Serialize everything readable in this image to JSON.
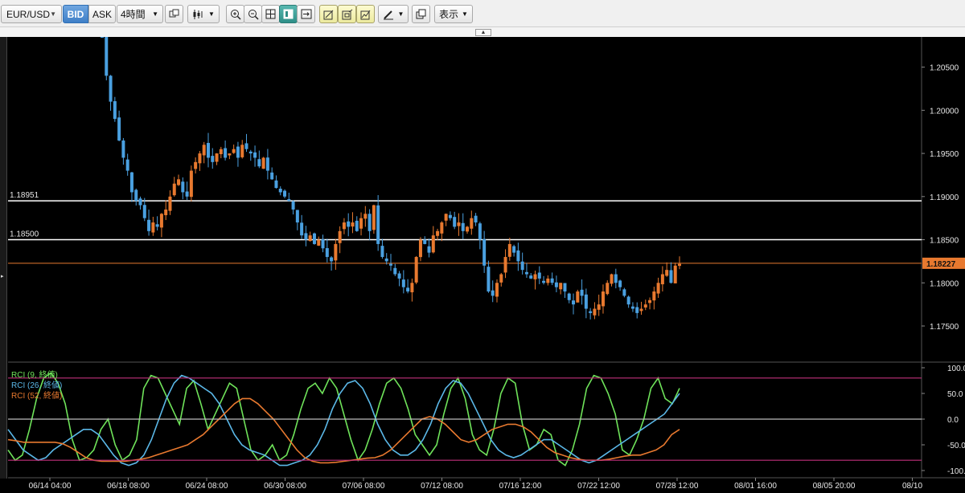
{
  "toolbar": {
    "symbol": "EUR/USD",
    "bid_label": "BID",
    "ask_label": "ASK",
    "timeframe": "4時間",
    "display_label": "表示",
    "icons": [
      "copy-icon",
      "candlestick-icon",
      "zoom-in-icon",
      "zoom-out-icon",
      "grid-icon",
      "panel-icon",
      "fit-icon",
      "draw-trend-icon",
      "draw-channel-icon",
      "draw-fib-icon",
      "pen-icon",
      "window-icon"
    ]
  },
  "chart_data": [
    {
      "type": "candlestick",
      "title": "EUR/USD 4時間",
      "x_ticks": [
        "06/14 04:00",
        "06/18 08:00",
        "06/24 08:00",
        "06/30 08:00",
        "07/06 08:00",
        "07/12 08:00",
        "07/16 12:00",
        "07/22 12:00",
        "07/28 12:00",
        "08/01 16:00",
        "08/05 20:00",
        "08/10"
      ],
      "y_ticks": [
        "1.20500",
        "1.20000",
        "1.19500",
        "1.19000",
        "1.18500",
        "1.18000",
        "1.17500"
      ],
      "ylim": [
        1.171,
        1.2085
      ],
      "current_price": "1.18227",
      "horizontal_levels": [
        "1.18951",
        "1.18500"
      ],
      "colors": {
        "up": "#e8792f",
        "down": "#4aa0e0",
        "level": "#ffffff",
        "current": "#e8792f"
      },
      "closes": [
        1.2095,
        1.204,
        1.201,
        1.199,
        1.1965,
        1.1945,
        1.193,
        1.1905,
        1.1895,
        1.189,
        1.1875,
        1.186,
        1.187,
        1.1865,
        1.188,
        1.1885,
        1.19,
        1.1915,
        1.192,
        1.1905,
        1.19,
        1.193,
        1.194,
        1.195,
        1.196,
        1.1945,
        1.194,
        1.195,
        1.1955,
        1.1945,
        1.195,
        1.1955,
        1.1945,
        1.196,
        1.1955,
        1.195,
        1.1945,
        1.1935,
        1.1945,
        1.193,
        1.192,
        1.191,
        1.1905,
        1.19,
        1.1895,
        1.1885,
        1.187,
        1.1855,
        1.185,
        1.1855,
        1.1845,
        1.185,
        1.184,
        1.183,
        1.1825,
        1.1845,
        1.186,
        1.187,
        1.1865,
        1.187,
        1.186,
        1.1875,
        1.188,
        1.186,
        1.189,
        1.1845,
        1.183,
        1.1825,
        1.182,
        1.181,
        1.1805,
        1.1795,
        1.179,
        1.18,
        1.183,
        1.185,
        1.1845,
        1.1835,
        1.1855,
        1.186,
        1.187,
        1.188,
        1.1875,
        1.1865,
        1.187,
        1.186,
        1.1865,
        1.1875,
        1.187,
        1.185,
        1.182,
        1.179,
        1.1785,
        1.18,
        1.181,
        1.183,
        1.1845,
        1.1835,
        1.1825,
        1.1815,
        1.181,
        1.1805,
        1.181,
        1.1805,
        1.18,
        1.1805,
        1.18,
        1.1795,
        1.18,
        1.179,
        1.178,
        1.1775,
        1.179,
        1.1785,
        1.177,
        1.1765,
        1.177,
        1.1775,
        1.179,
        1.18,
        1.181,
        1.18,
        1.1795,
        1.1785,
        1.1775,
        1.177,
        1.1765,
        1.177,
        1.1775,
        1.178,
        1.179,
        1.18,
        1.181,
        1.1815,
        1.18,
        1.182,
        1.1822
      ]
    },
    {
      "type": "line",
      "title": "RCI",
      "y_ticks": [
        "100.0",
        "50.0",
        "0.0",
        "-50.0",
        "-100.0"
      ],
      "ylim": [
        -100,
        100
      ],
      "reference_lines": [
        80,
        0,
        -80
      ],
      "series": [
        {
          "name": "RCI (9, 終値)",
          "color": "#6fe35a",
          "values": [
            -60,
            -80,
            -70,
            -20,
            40,
            80,
            90,
            70,
            30,
            -40,
            -80,
            -75,
            -60,
            -20,
            0,
            -50,
            -80,
            -70,
            -40,
            60,
            85,
            80,
            50,
            20,
            -10,
            60,
            75,
            30,
            -20,
            10,
            40,
            70,
            60,
            0,
            -60,
            -80,
            -70,
            -50,
            -80,
            -70,
            -30,
            20,
            60,
            70,
            50,
            80,
            60,
            10,
            -40,
            -80,
            -60,
            -20,
            30,
            70,
            80,
            60,
            20,
            -30,
            -50,
            -70,
            -50,
            10,
            60,
            80,
            40,
            -30,
            -60,
            -70,
            -20,
            50,
            80,
            70,
            -10,
            -60,
            -50,
            -20,
            -30,
            -80,
            -90,
            -60,
            -10,
            60,
            85,
            80,
            50,
            10,
            -60,
            -70,
            -40,
            0,
            60,
            80,
            40,
            30,
            60
          ]
        },
        {
          "name": "RCI (26, 終値)",
          "color": "#5bb8e8",
          "values": [
            -20,
            -40,
            -60,
            -70,
            -80,
            -75,
            -60,
            -50,
            -40,
            -30,
            -20,
            -20,
            -30,
            -50,
            -70,
            -85,
            -90,
            -85,
            -70,
            -40,
            0,
            40,
            70,
            85,
            80,
            70,
            60,
            50,
            30,
            0,
            -30,
            -50,
            -60,
            -65,
            -70,
            -80,
            -90,
            -90,
            -85,
            -80,
            -70,
            -50,
            -20,
            20,
            50,
            70,
            75,
            60,
            30,
            -10,
            -40,
            -60,
            -70,
            -70,
            -60,
            -40,
            -10,
            30,
            60,
            75,
            70,
            50,
            20,
            -10,
            -40,
            -60,
            -70,
            -75,
            -70,
            -60,
            -50,
            -40,
            -40,
            -50,
            -60,
            -70,
            -80,
            -85,
            -80,
            -70,
            -60,
            -50,
            -40,
            -30,
            -20,
            -10,
            0,
            10,
            30,
            50
          ]
        },
        {
          "name": "RCI (52, 終値)",
          "color": "#e8792f",
          "values": [
            -40,
            -42,
            -45,
            -45,
            -45,
            -45,
            -45,
            -48,
            -55,
            -65,
            -75,
            -80,
            -82,
            -82,
            -82,
            -82,
            -80,
            -78,
            -75,
            -70,
            -65,
            -60,
            -55,
            -50,
            -40,
            -30,
            -15,
            0,
            15,
            30,
            40,
            40,
            30,
            15,
            0,
            -20,
            -40,
            -60,
            -75,
            -82,
            -85,
            -85,
            -84,
            -82,
            -80,
            -78,
            -76,
            -75,
            -70,
            -60,
            -45,
            -30,
            -15,
            0,
            5,
            0,
            -10,
            -25,
            -40,
            -45,
            -40,
            -30,
            -20,
            -15,
            -10,
            -10,
            -15,
            -25,
            -40,
            -55,
            -65,
            -70,
            -75,
            -78,
            -80,
            -80,
            -80,
            -78,
            -75,
            -72,
            -70,
            -70,
            -65,
            -60,
            -50,
            -30,
            -20
          ]
        }
      ]
    }
  ]
}
